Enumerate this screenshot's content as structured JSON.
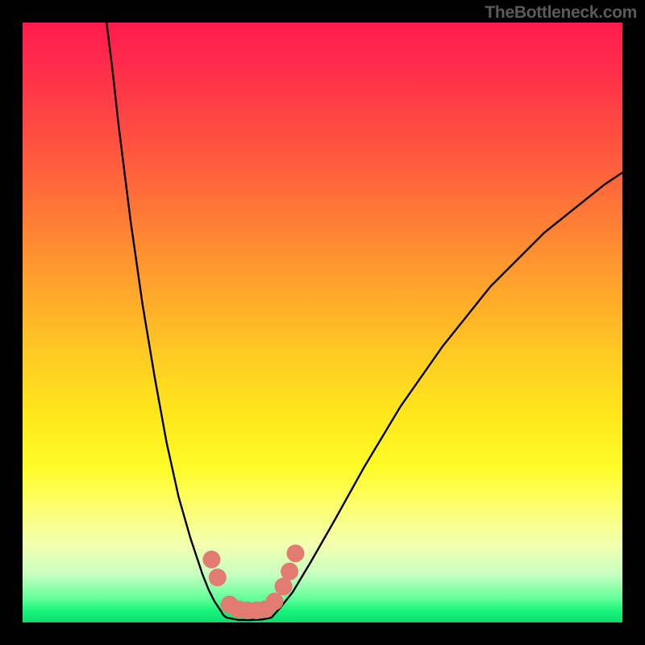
{
  "watermark": "TheBottleneck.com",
  "chart_data": {
    "type": "line",
    "title": "",
    "xlabel": "",
    "ylabel": "",
    "xlim": [
      0,
      100
    ],
    "ylim": [
      0,
      100
    ],
    "grid": false,
    "series": [
      {
        "name": "bottleneck-curve-left",
        "x": [
          14,
          15,
          16,
          18,
          20,
          22,
          24,
          26,
          28,
          29,
          30,
          31,
          32,
          33,
          33.5,
          34
        ],
        "y": [
          100,
          92,
          83,
          67,
          53,
          41,
          30,
          21,
          14,
          11,
          8,
          5.5,
          3.5,
          2,
          1.2,
          0.8
        ]
      },
      {
        "name": "bottleneck-curve-bottom",
        "x": [
          34,
          36,
          38,
          40,
          41.5
        ],
        "y": [
          0.8,
          0.4,
          0.4,
          0.5,
          0.8
        ]
      },
      {
        "name": "bottleneck-curve-right",
        "x": [
          41.5,
          43,
          45,
          48,
          52,
          57,
          63,
          70,
          78,
          87,
          97,
          100
        ],
        "y": [
          0.8,
          2.5,
          5,
          10,
          17,
          26,
          36,
          46,
          56,
          65,
          73,
          75
        ]
      }
    ],
    "markers": {
      "name": "highlighted-points",
      "color": "#e27b72",
      "points": [
        {
          "x": 31.5,
          "y": 10.5
        },
        {
          "x": 32.5,
          "y": 7.5
        },
        {
          "x": 34.5,
          "y": 3.0
        },
        {
          "x": 36.0,
          "y": 2.2
        },
        {
          "x": 37.5,
          "y": 2.0
        },
        {
          "x": 39.0,
          "y": 2.0
        },
        {
          "x": 40.5,
          "y": 2.2
        },
        {
          "x": 42.0,
          "y": 3.5
        },
        {
          "x": 43.5,
          "y": 6.0
        },
        {
          "x": 44.5,
          "y": 8.5
        },
        {
          "x": 45.5,
          "y": 11.5
        }
      ]
    }
  }
}
